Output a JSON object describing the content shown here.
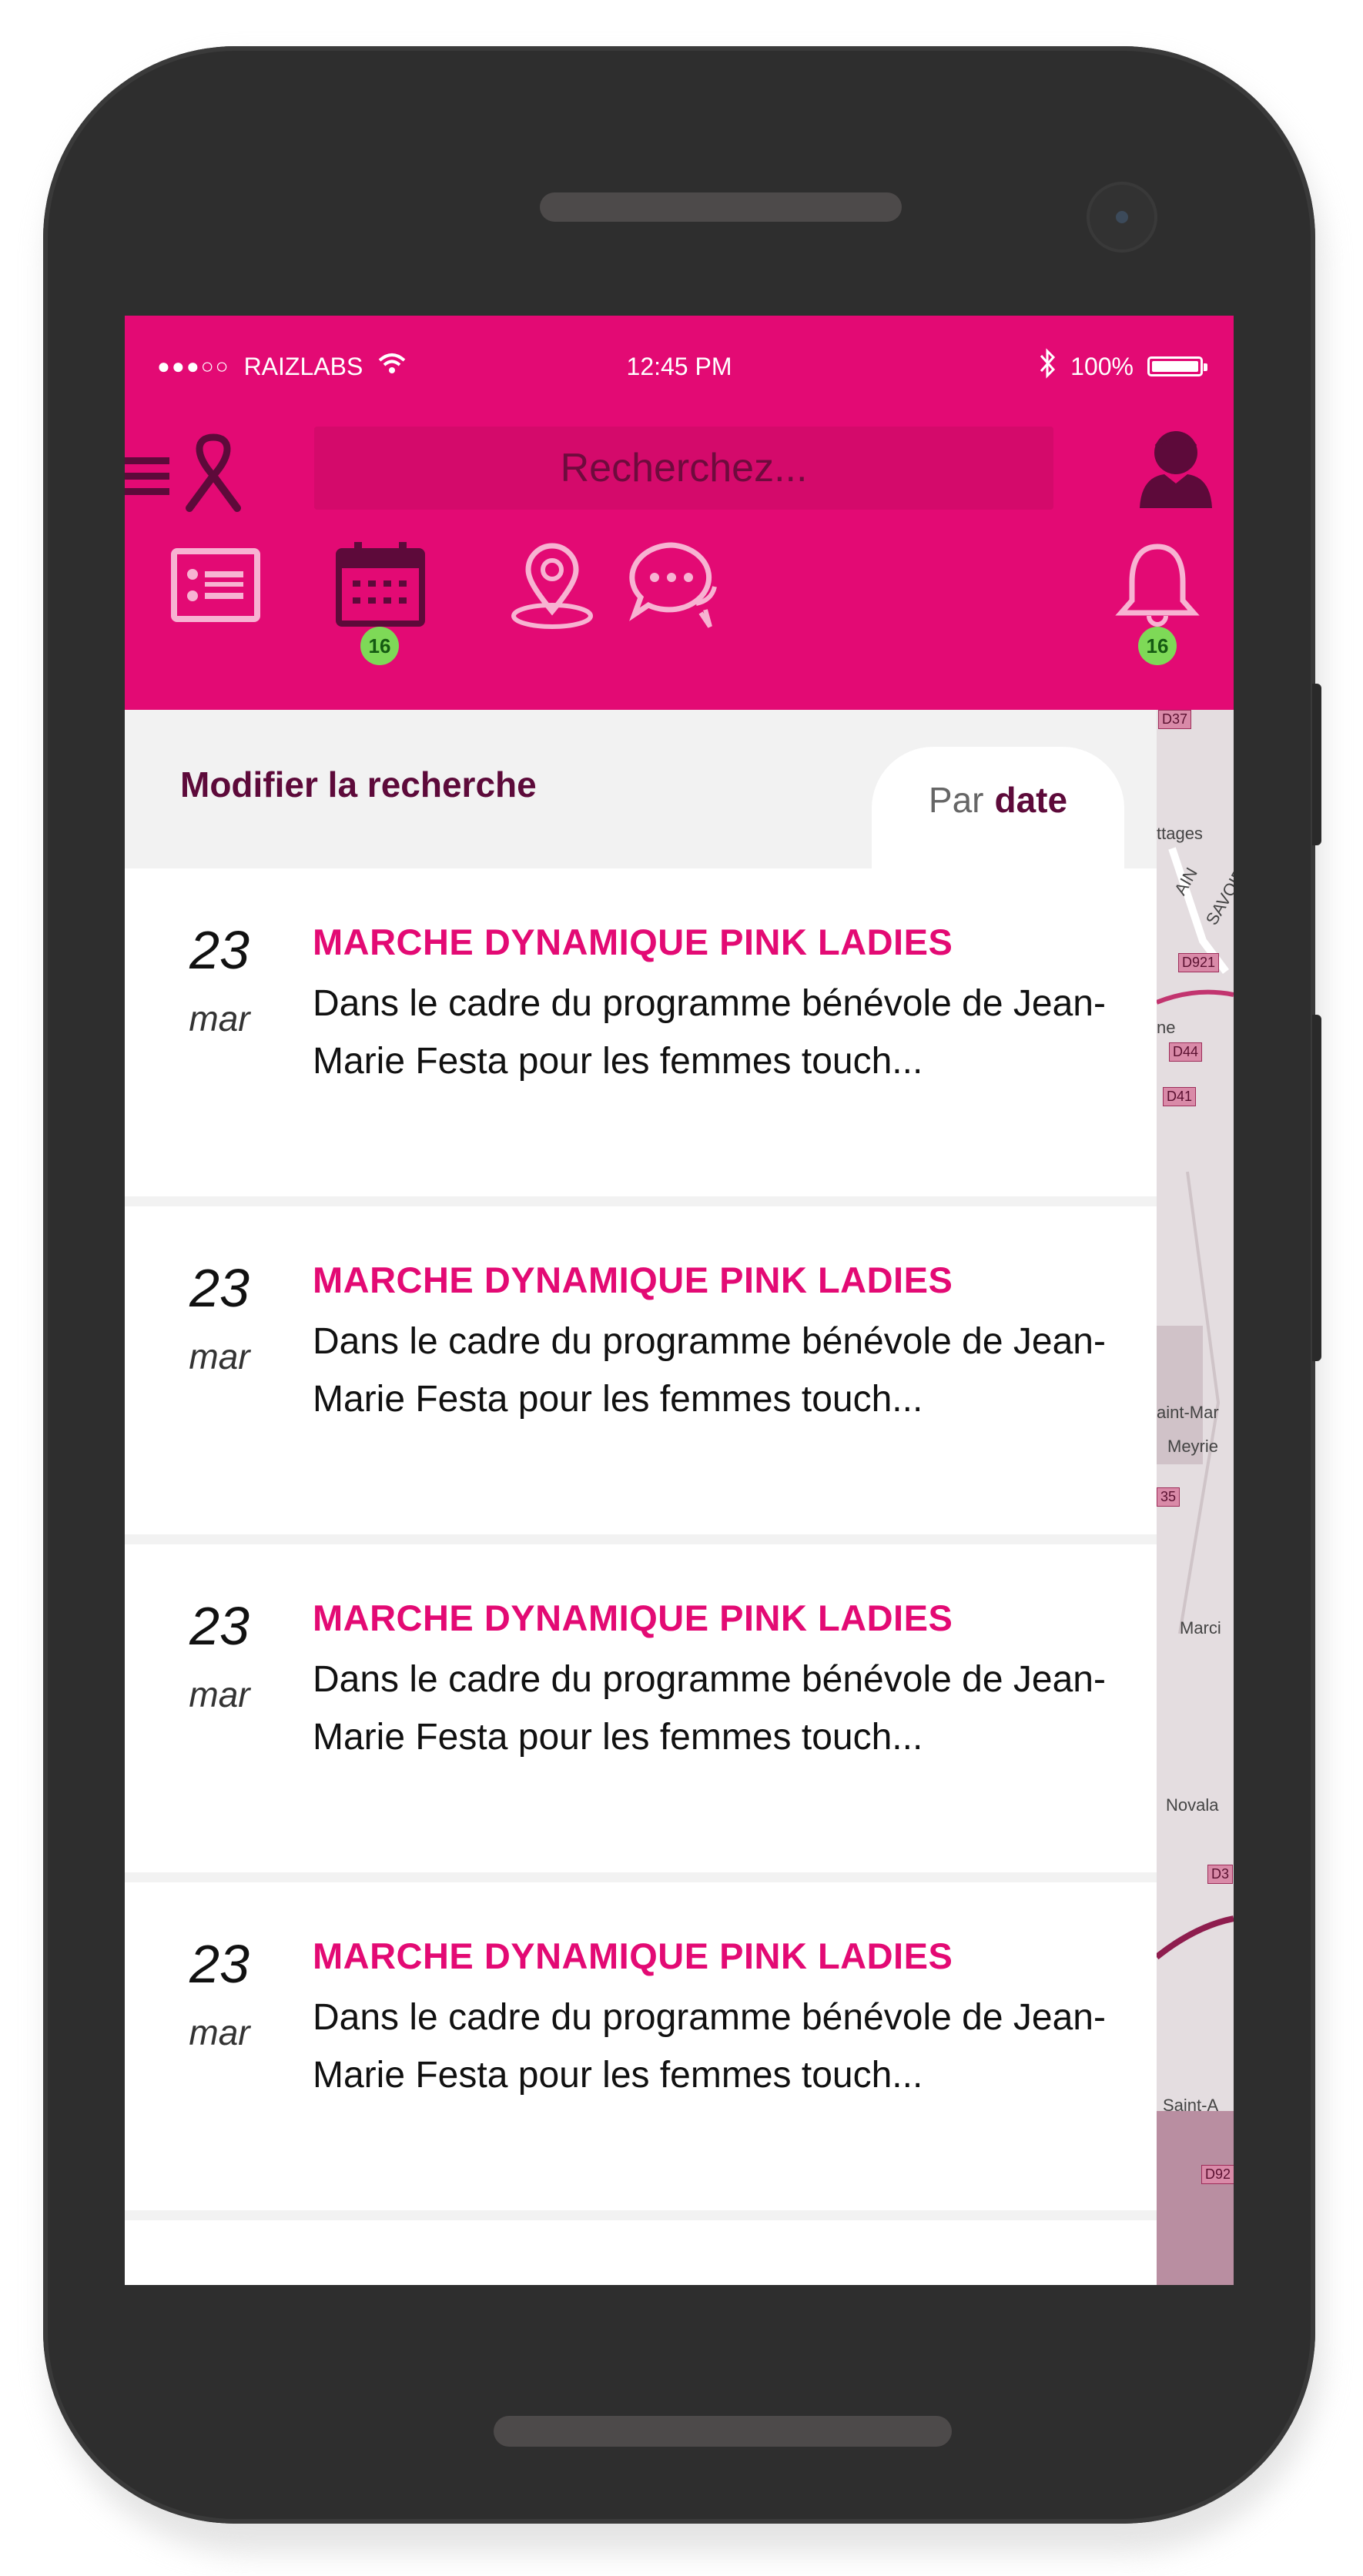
{
  "status_bar": {
    "signal": "●●●○○",
    "carrier": "RAIZLABS",
    "time": "12:45 PM",
    "battery": "100%"
  },
  "header": {
    "search_placeholder": "Recherchez...",
    "calendar_badge": "16",
    "notifications_badge": "16"
  },
  "filter": {
    "modify_label": "Modifier la recherche",
    "sort_prefix": "Par",
    "sort_value": "date"
  },
  "events": [
    {
      "day": "23",
      "month": "mar",
      "title": "MARCHE DYNAMIQUE PINK LADIES",
      "description": "Dans le cadre du programme bénévole de Jean-Marie Festa pour les femmes touch..."
    },
    {
      "day": "23",
      "month": "mar",
      "title": "MARCHE DYNAMIQUE PINK LADIES",
      "description": "Dans le cadre du programme bénévole de Jean-Marie Festa pour les femmes touch..."
    },
    {
      "day": "23",
      "month": "mar",
      "title": "MARCHE DYNAMIQUE PINK LADIES",
      "description": "Dans le cadre du programme bénévole de Jean-Marie Festa pour les femmes touch..."
    },
    {
      "day": "23",
      "month": "mar",
      "title": "MARCHE DYNAMIQUE PINK LADIES",
      "description": "Dans le cadre du programme bénévole de Jean-Marie Festa pour les femmes touch..."
    }
  ],
  "map_labels": [
    "D37",
    "ttages",
    "AIN",
    "SAVOIE",
    "D921",
    "ne",
    "D44",
    "D41",
    "aint-Mar",
    "Meyrie",
    "35",
    "Marci",
    "Novala",
    "D3",
    "Saint-A",
    "D92"
  ],
  "colors": {
    "brand_pink": "#e30a74",
    "dark_plum": "#5d0a3a",
    "badge_green": "#7ed957"
  },
  "icons": [
    "menu-icon",
    "ribbon-icon",
    "avatar-icon",
    "list-icon",
    "calendar-icon",
    "location-pin-icon",
    "chat-icon",
    "bell-icon",
    "wifi-icon",
    "bluetooth-icon",
    "battery-icon"
  ]
}
